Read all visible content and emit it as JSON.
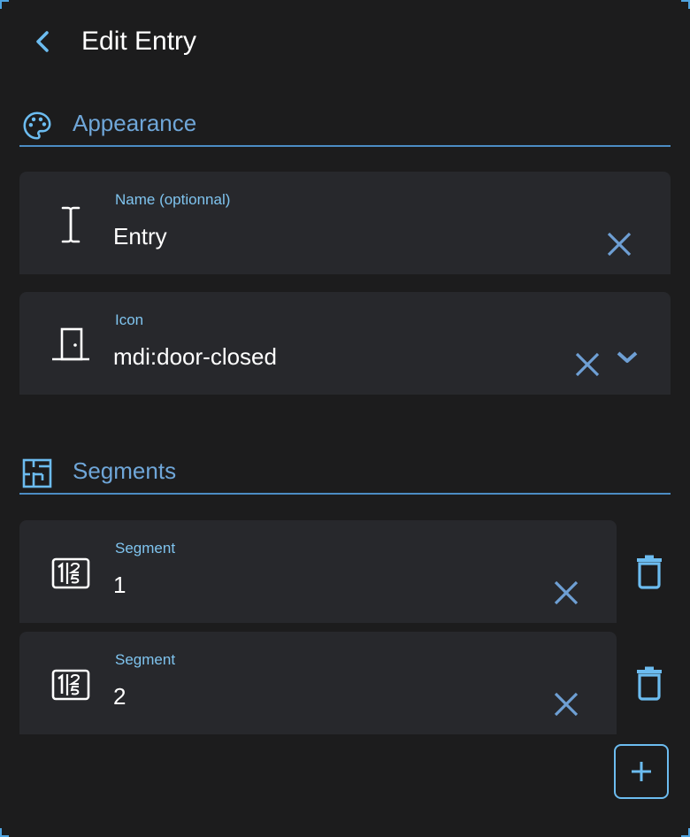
{
  "header": {
    "title": "Edit Entry",
    "back_icon": "chevron-left-icon"
  },
  "appearance": {
    "title": "Appearance",
    "icon": "palette-icon",
    "name_field": {
      "label": "Name (optionnal)",
      "value": "Entry",
      "icon": "text-cursor-icon"
    },
    "icon_field": {
      "label": "Icon",
      "value": "mdi:door-closed",
      "icon": "door-closed-icon"
    }
  },
  "segments": {
    "title": "Segments",
    "icon": "floor-plan-icon",
    "items": [
      {
        "label": "Segment",
        "value": "1",
        "icon": "numeric-segment-icon"
      },
      {
        "label": "Segment",
        "value": "2",
        "icon": "numeric-segment-icon"
      }
    ],
    "add_icon": "plus-icon",
    "delete_icon": "trash-icon"
  },
  "colors": {
    "background": "#1c1c1d",
    "card": "#27282c",
    "accent": "#6cbcf0",
    "section_text": "#6fa6d8",
    "clear_icon": "#6e9fd4"
  }
}
